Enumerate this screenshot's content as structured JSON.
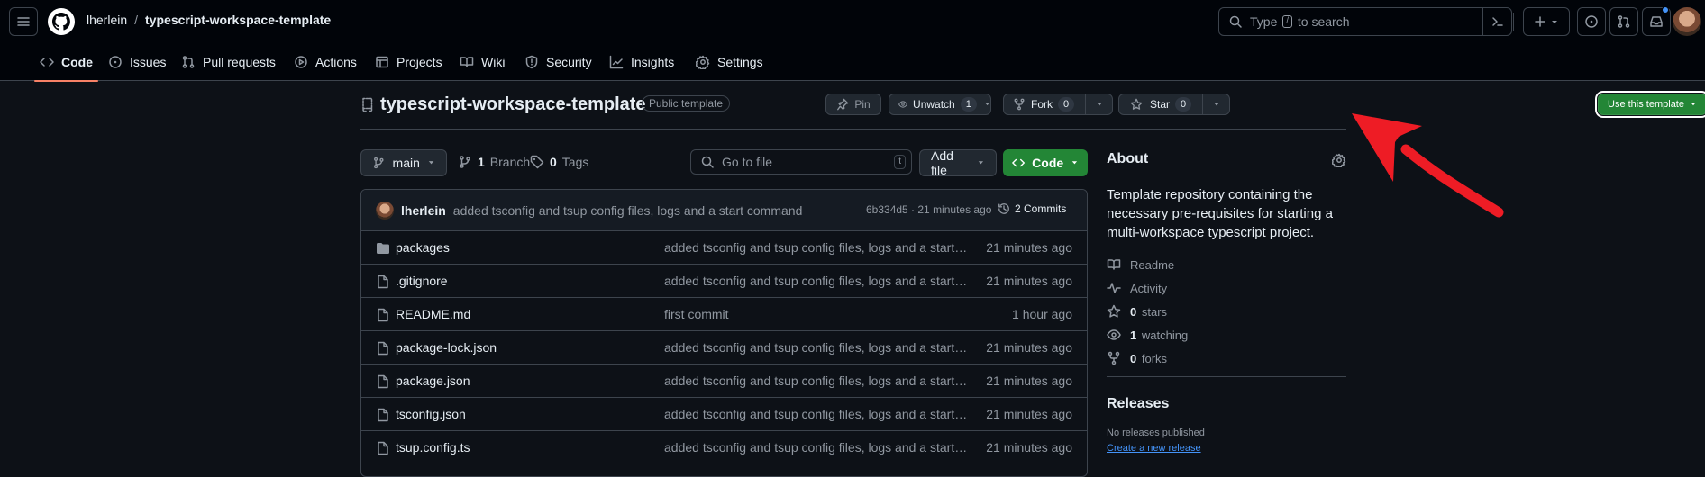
{
  "header": {
    "owner": "lherlein",
    "separator": "/",
    "repo": "typescript-workspace-template",
    "search_prefix": "Type",
    "search_key": "/",
    "search_suffix": "to search"
  },
  "tabs": [
    {
      "label": "Code"
    },
    {
      "label": "Issues"
    },
    {
      "label": "Pull requests"
    },
    {
      "label": "Actions"
    },
    {
      "label": "Projects"
    },
    {
      "label": "Wiki"
    },
    {
      "label": "Security"
    },
    {
      "label": "Insights"
    },
    {
      "label": "Settings"
    }
  ],
  "repo": {
    "name": "typescript-workspace-template",
    "visibility_badge": "Public template",
    "pin_label": "Pin",
    "unwatch_label": "Unwatch",
    "watch_count": "1",
    "fork_label": "Fork",
    "fork_count": "0",
    "star_label": "Star",
    "star_count": "0",
    "use_template_label": "Use this template"
  },
  "branch_bar": {
    "branch": "main",
    "branch_count": "1",
    "branch_label": "Branch",
    "tag_count": "0",
    "tag_label": "Tags",
    "go_to_file_placeholder": "Go to file",
    "go_to_file_key": "t",
    "add_file_label": "Add file",
    "code_label": "Code"
  },
  "latest_commit": {
    "author": "lherlein",
    "message": "added tsconfig and tsup config files, logs and a start command",
    "sha_time": "6b334d5 · 21 minutes ago",
    "commits_label": "2 Commits"
  },
  "files": [
    {
      "name": "packages",
      "type": "folder",
      "message": "added tsconfig and tsup config files, logs and a start co...",
      "time": "21 minutes ago"
    },
    {
      "name": ".gitignore",
      "type": "file",
      "message": "added tsconfig and tsup config files, logs and a start co...",
      "time": "21 minutes ago"
    },
    {
      "name": "README.md",
      "type": "file",
      "message": "first commit",
      "time": "1 hour ago"
    },
    {
      "name": "package-lock.json",
      "type": "file",
      "message": "added tsconfig and tsup config files, logs and a start co...",
      "time": "21 minutes ago"
    },
    {
      "name": "package.json",
      "type": "file",
      "message": "added tsconfig and tsup config files, logs and a start co...",
      "time": "21 minutes ago"
    },
    {
      "name": "tsconfig.json",
      "type": "file",
      "message": "added tsconfig and tsup config files, logs and a start co...",
      "time": "21 minutes ago"
    },
    {
      "name": "tsup.config.ts",
      "type": "file",
      "message": "added tsconfig and tsup config files, logs and a start co...",
      "time": "21 minutes ago"
    }
  ],
  "about": {
    "title": "About",
    "description": "Template repository containing the necessary pre-requisites for starting a multi-workspace typescript project.",
    "readme": "Readme",
    "activity": "Activity",
    "stars_count": "0",
    "stars_label": "stars",
    "watching_count": "1",
    "watching_label": "watching",
    "forks_count": "0",
    "forks_label": "forks"
  },
  "releases": {
    "title": "Releases",
    "none_text": "No releases published",
    "create_link": "Create a new release"
  },
  "colors": {
    "background": "#0d1117",
    "header_bg": "#010409",
    "primary_green": "#238636",
    "accent_link": "#4493f8",
    "annotation_arrow": "#ee1c25"
  }
}
